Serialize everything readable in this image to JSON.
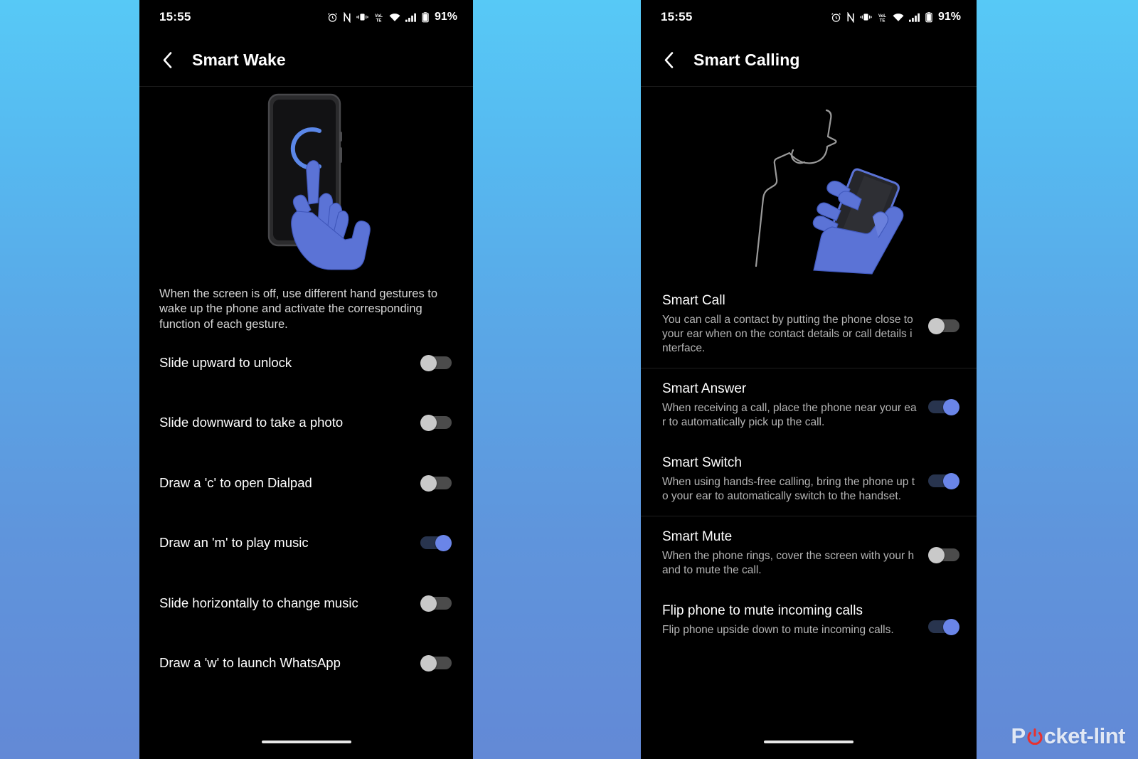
{
  "background": {
    "top_color": "#57c9f6",
    "bottom_color": "#6389d6"
  },
  "watermark": {
    "text_before": "P",
    "text_after": "cket-lint",
    "icon": "power-icon",
    "accent": "#e8312f"
  },
  "status_bar": {
    "time": "15:55",
    "battery_percent": "91%",
    "icons": [
      "alarm-icon",
      "nfc-icon",
      "vibrate-icon",
      "volte-icon",
      "wifi-icon",
      "signal-icon",
      "battery-icon"
    ]
  },
  "phones": [
    {
      "id": "smart-wake",
      "app_bar": {
        "back_icon": "chevron-left-icon",
        "title": "Smart Wake"
      },
      "illustration": "phone-with-c-gesture-hand-illustration",
      "description": "When the screen is off, use different hand gestures to wake up the phone and activate the corresponding function of each gesture.",
      "rows": [
        {
          "label": "Slide upward to unlock",
          "enabled": false
        },
        {
          "label": "Slide downward to take a photo",
          "enabled": false
        },
        {
          "label": "Draw a 'c' to open Dialpad",
          "enabled": false
        },
        {
          "label": "Draw an 'm' to play music",
          "enabled": true
        },
        {
          "label": "Slide horizontally to change music",
          "enabled": false
        },
        {
          "label": "Draw a 'w' to launch WhatsApp",
          "enabled": false
        }
      ]
    },
    {
      "id": "smart-calling",
      "app_bar": {
        "back_icon": "chevron-left-icon",
        "title": "Smart Calling"
      },
      "illustration": "person-holding-phone-to-ear-illustration",
      "groups": [
        {
          "rows": [
            {
              "title": "Smart Call",
              "subtitle": "You can call a contact by putting the phone close to your ear when on the contact details or call details interface.",
              "enabled": false
            }
          ]
        },
        {
          "rows": [
            {
              "title": "Smart Answer",
              "subtitle": "When receiving a call, place the phone near your ear to automatically pick up the call.",
              "enabled": true
            },
            {
              "title": "Smart Switch",
              "subtitle": "When using hands-free calling, bring the phone up to your ear to automatically switch to the handset.",
              "enabled": true
            }
          ]
        },
        {
          "rows": [
            {
              "title": "Smart Mute",
              "subtitle": "When the phone rings, cover the screen with your hand to mute the call.",
              "enabled": false
            },
            {
              "title": "Flip phone to mute incoming calls",
              "subtitle": "Flip phone upside down to mute incoming calls.",
              "enabled": true
            }
          ]
        }
      ]
    }
  ]
}
